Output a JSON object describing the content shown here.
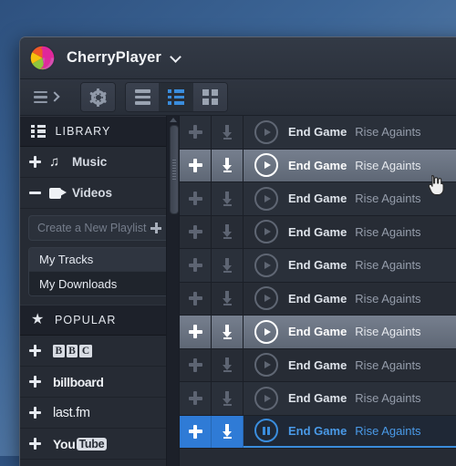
{
  "app": {
    "title": "CherryPlayer",
    "logo_icon": "cherry-logo",
    "caret_icon": "chevron-down-icon"
  },
  "toolbar": {
    "menu_icon": "hamburger-icon",
    "expand_icon": "chevron-right-icon",
    "settings_icon": "gear-icon",
    "view_rows_icon": "list-rows-icon",
    "view_list_icon": "detailed-list-icon",
    "view_grid_icon": "grid-icon",
    "active_view": "detailed-list",
    "accent_color": "#3a8ddd"
  },
  "sidebar": {
    "library": {
      "label": "LIBRARY",
      "icon": "library-icon",
      "items": [
        {
          "label": "Music",
          "icon": "music-note-icon",
          "toggle": "plus",
          "expanded": false
        },
        {
          "label": "Videos",
          "icon": "video-camera-icon",
          "toggle": "minus",
          "expanded": true
        }
      ]
    },
    "playlists": {
      "create_placeholder": "Create a New Playlist",
      "create_icon": "plus-icon",
      "items": [
        {
          "label": "My Tracks",
          "selected": true
        },
        {
          "label": "My Downloads",
          "selected": false
        }
      ]
    },
    "popular": {
      "label": "POPULAR",
      "icon": "star-icon",
      "items": [
        {
          "label": "BBC",
          "kind": "bbc",
          "toggle": "plus"
        },
        {
          "label": "billboard",
          "kind": "billboard",
          "toggle": "plus"
        },
        {
          "label": "last.fm",
          "kind": "lastfm",
          "toggle": "plus"
        },
        {
          "label": "YouTube",
          "kind": "youtube",
          "toggle": "plus"
        }
      ]
    },
    "scrollbar": {
      "up_icon": "scroll-up-arrow"
    }
  },
  "tracklist": {
    "add_icon": "plus-icon",
    "download_icon": "download-icon",
    "play_icon": "play-icon",
    "pause_icon": "pause-icon",
    "selected_color": "#2f7bd6",
    "rows": [
      {
        "title": "End Game",
        "artist": "Rise Againts",
        "state": "normal",
        "playing": false
      },
      {
        "title": "End Game",
        "artist": "Rise Againts",
        "state": "hover",
        "playing": false
      },
      {
        "title": "End Game",
        "artist": "Rise Againts",
        "state": "normal",
        "playing": false
      },
      {
        "title": "End Game",
        "artist": "Rise Againts",
        "state": "normal",
        "playing": false
      },
      {
        "title": "End Game",
        "artist": "Rise Againts",
        "state": "normal",
        "playing": false
      },
      {
        "title": "End Game",
        "artist": "Rise Againts",
        "state": "normal",
        "playing": false
      },
      {
        "title": "End Game",
        "artist": "Rise Againts",
        "state": "hover",
        "playing": false
      },
      {
        "title": "End Game",
        "artist": "Rise Againts",
        "state": "normal",
        "playing": false
      },
      {
        "title": "End Game",
        "artist": "Rise Againts",
        "state": "normal",
        "playing": false
      },
      {
        "title": "End Game",
        "artist": "Rise Againts",
        "state": "selected",
        "playing": true
      }
    ]
  },
  "cursor": {
    "icon": "hand-pointer-cursor"
  }
}
